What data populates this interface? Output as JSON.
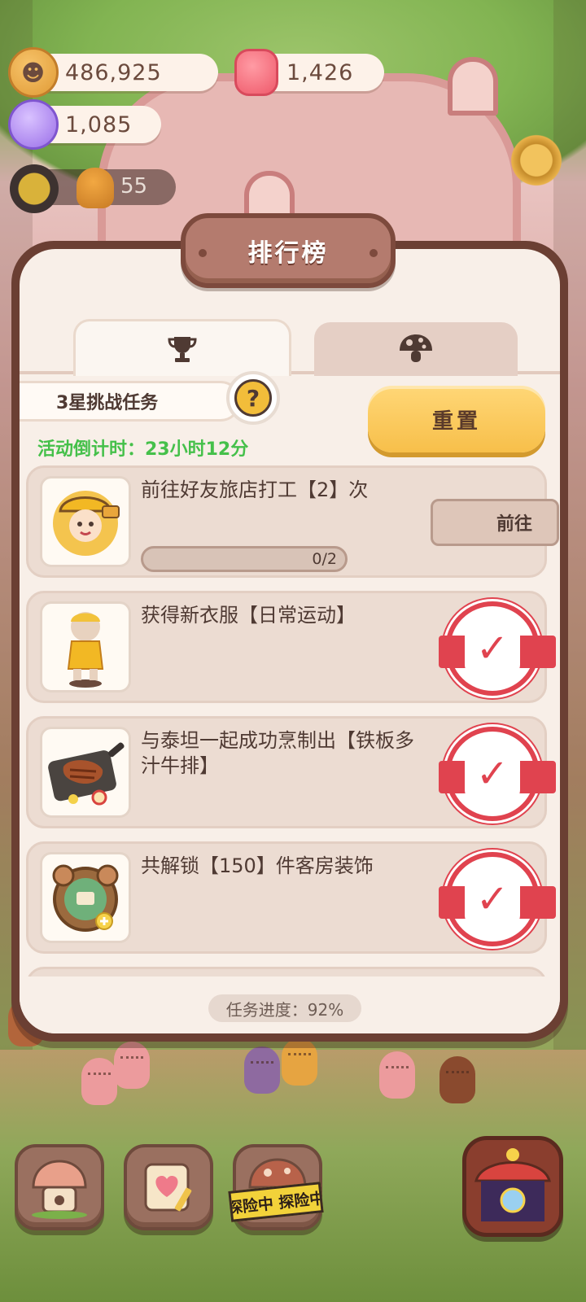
{
  "hud": {
    "cookies": "486,925",
    "jelly": "1,426",
    "crystals": "1,085",
    "energy": "55"
  },
  "modal": {
    "title": "排行榜",
    "tabs": [
      {
        "icon": "trophy-icon",
        "active": true
      },
      {
        "icon": "mushroom-icon",
        "active": false
      }
    ],
    "task_group_label": "3星挑战任务",
    "help_symbol": "?",
    "countdown": "活动倒计时：23小时12分",
    "reset_label": "重置",
    "tasks": [
      {
        "title": "前往好友旅店打工【2】次",
        "status": "in_progress",
        "progress_text": "0/2",
        "progress": 0,
        "action_label": "前往",
        "thumb": "worker-girl"
      },
      {
        "title": "获得新衣服【日常运动】",
        "status": "done",
        "thumb": "sport-outfit"
      },
      {
        "title": "与泰坦一起成功烹制出【铁板多汁牛排】",
        "status": "done",
        "thumb": "steak-plate"
      },
      {
        "title": "共解锁【150】件客房装饰",
        "status": "done",
        "thumb": "decor-badge"
      }
    ],
    "done_mark": "✓",
    "overall_progress": "任务进度：92%"
  },
  "dock": {
    "tape_text": "探险中 探险中"
  },
  "colors": {
    "accent_yellow": "#f7bf4a",
    "countdown_green": "#45c04a",
    "stamp_red": "#e0434f",
    "frame_brown": "#6b3f33"
  }
}
